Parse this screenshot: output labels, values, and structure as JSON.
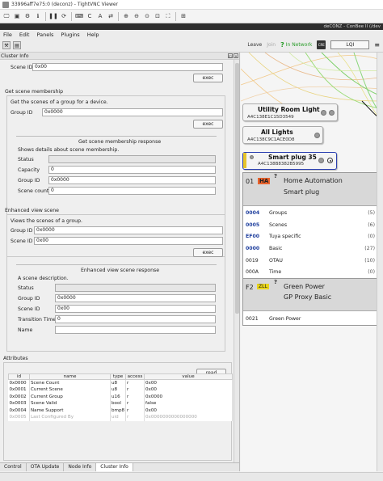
{
  "vnc": {
    "title": "33996aff7e75:0 (deconz) - TightVNC Viewer"
  },
  "app": {
    "window_title": "deCONZ - ConBee II (/dev",
    "menu": [
      "File",
      "Edit",
      "Panels",
      "Plugins",
      "Help"
    ],
    "toolbar": {
      "leave": "Leave",
      "join": "Join",
      "network_status": "In Network",
      "lqi": "LQI"
    }
  },
  "panel": {
    "title": "Cluster Info",
    "scene_id_label": "Scene ID",
    "scene_id_value": "0x00",
    "exec_label": "exec",
    "get_membership": {
      "title": "Get scene membership",
      "desc": "Get the scenes of a group for a device.",
      "group_id_label": "Group ID",
      "group_id_value": "0x0000",
      "exec_label": "exec",
      "response_title": "Get scene membership response",
      "response_desc": "Shows details about scene membership.",
      "status_label": "Status",
      "capacity_label": "Capacity",
      "capacity_value": "0",
      "group_id_value2": "0x0000",
      "scene_count_label": "Scene count",
      "scene_count_value": "0"
    },
    "enhanced_view": {
      "title": "Enhanced view scene",
      "desc": "Views the scenes of a group.",
      "group_id_label": "Group ID",
      "group_id_value": "0x0000",
      "scene_id_label": "Scene ID",
      "scene_id_value": "0x00",
      "exec_label": "exec",
      "response_title": "Enhanced view scene response",
      "response_desc": "A scene description.",
      "status_label": "Status",
      "group_id_value2": "0x0000",
      "scene_id_value2": "0x00",
      "transition_label": "Transition Time",
      "transition_value": "0",
      "name_label": "Name",
      "name_value": ""
    },
    "attributes": {
      "title": "Attributes",
      "read_label": "read",
      "columns": [
        "id",
        "name",
        "type",
        "access",
        "value"
      ],
      "rows": [
        [
          "0x0000",
          "Scene Count",
          "u8",
          "r",
          "0x00"
        ],
        [
          "0x0001",
          "Current Scene",
          "u8",
          "r",
          "0x00"
        ],
        [
          "0x0002",
          "Current Group",
          "u16",
          "r",
          "0x0000"
        ],
        [
          "0x0003",
          "Scene Valid",
          "bool",
          "r",
          "false"
        ],
        [
          "0x0004",
          "Name Support",
          "bmp8",
          "r",
          "0x00"
        ],
        [
          "0x0005",
          "Last Configured By",
          "uid",
          "r",
          "0x0000000000000000"
        ]
      ]
    },
    "tabs": [
      "Control",
      "OTA Update",
      "Node Info",
      "Cluster Info"
    ]
  },
  "graph": {
    "nodes": [
      {
        "title": "Utility Room Light",
        "mac": "A4C138E1C15D3549"
      },
      {
        "title": "All Lights",
        "mac": "A4C138C9C1ACE0D8"
      },
      {
        "title": "Smart plug 35",
        "mac": "A4C138B8382B5995"
      }
    ],
    "endpoint1": {
      "ep": "01",
      "badge": "HA",
      "profile": "Home Automation",
      "device": "Smart plug",
      "clusters": [
        {
          "id": "0004",
          "name": "Groups",
          "count": "(5)",
          "link": true
        },
        {
          "id": "0005",
          "name": "Scenes",
          "count": "(6)",
          "link": true
        },
        {
          "id": "EF00",
          "name": "Tuya specific",
          "count": "(0)",
          "link": true
        },
        {
          "id": "0000",
          "name": "Basic",
          "count": "(27)",
          "link": true
        },
        {
          "id": "0019",
          "name": "OTAU",
          "count": "(10)",
          "link": false
        },
        {
          "id": "000A",
          "name": "Time",
          "count": "(0)",
          "link": false
        }
      ]
    },
    "endpoint2": {
      "ep": "F2",
      "badge": "ZLL",
      "profile": "Green Power",
      "device": "GP Proxy Basic",
      "clusters": [
        {
          "id": "0021",
          "name": "Green Power",
          "count": "",
          "link": false
        }
      ]
    },
    "colors": {
      "badge_ha": "#e8622c",
      "badge_zll": "#e8d41a",
      "link": "#1f3f9e",
      "selected": "#2a3fb0"
    }
  }
}
